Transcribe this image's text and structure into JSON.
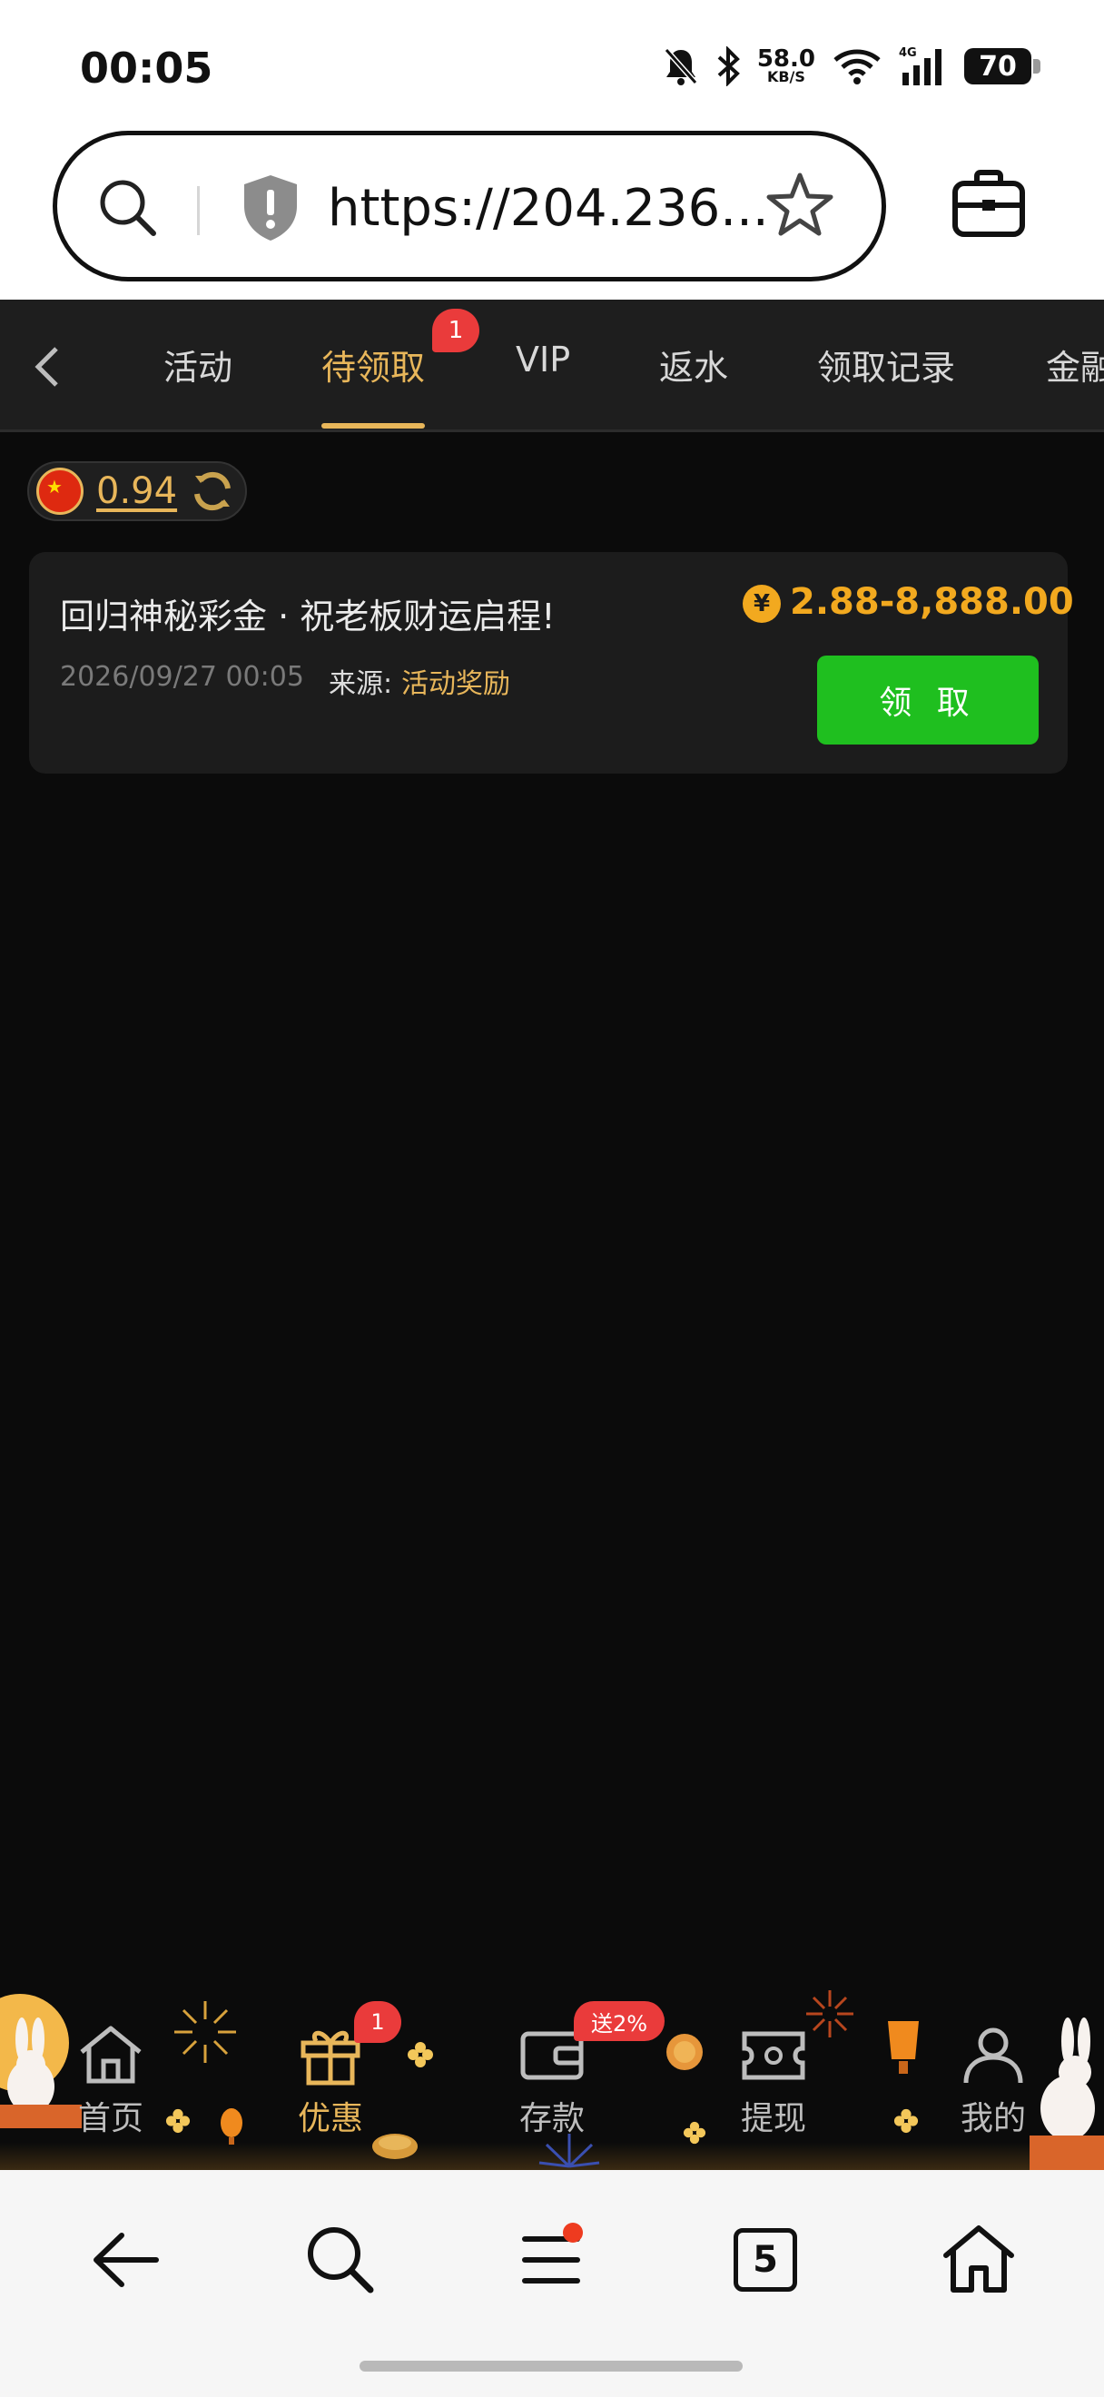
{
  "status_bar": {
    "time": "00:05",
    "net_speed": "58.0",
    "net_speed_unit": "KB/S",
    "network": "4G",
    "battery": "70"
  },
  "browser": {
    "url": "https://204.236...",
    "tabs_count": "5"
  },
  "tabs": {
    "items": [
      "活动",
      "待领取",
      "VIP",
      "返水",
      "领取记录",
      "金融"
    ],
    "active": "待领取",
    "badge": "1"
  },
  "balance": {
    "amount": "0.94"
  },
  "reward": {
    "title": "回归神秘彩金 · 祝老板财运启程!",
    "date": "2026/09/27 00:05",
    "source_label": "来源:",
    "source_value": "活动奖励",
    "currency_symbol": "¥",
    "amount": "2.88-8,888.00",
    "claim_label": "领 取"
  },
  "bottom_nav": {
    "items": [
      {
        "label": "首页",
        "icon": "home-icon"
      },
      {
        "label": "优惠",
        "icon": "gift-icon",
        "badge": "1"
      },
      {
        "label": "存款",
        "icon": "wallet-icon",
        "badge": "送2%"
      },
      {
        "label": "提现",
        "icon": "withdraw-icon"
      },
      {
        "label": "我的",
        "icon": "user-icon"
      }
    ],
    "active": "优惠"
  },
  "colors": {
    "accent_gold": "#e8b65a",
    "amount_orange": "#f2a91f",
    "claim_green": "#1fbf1f",
    "badge_red": "#ea3b3b"
  }
}
